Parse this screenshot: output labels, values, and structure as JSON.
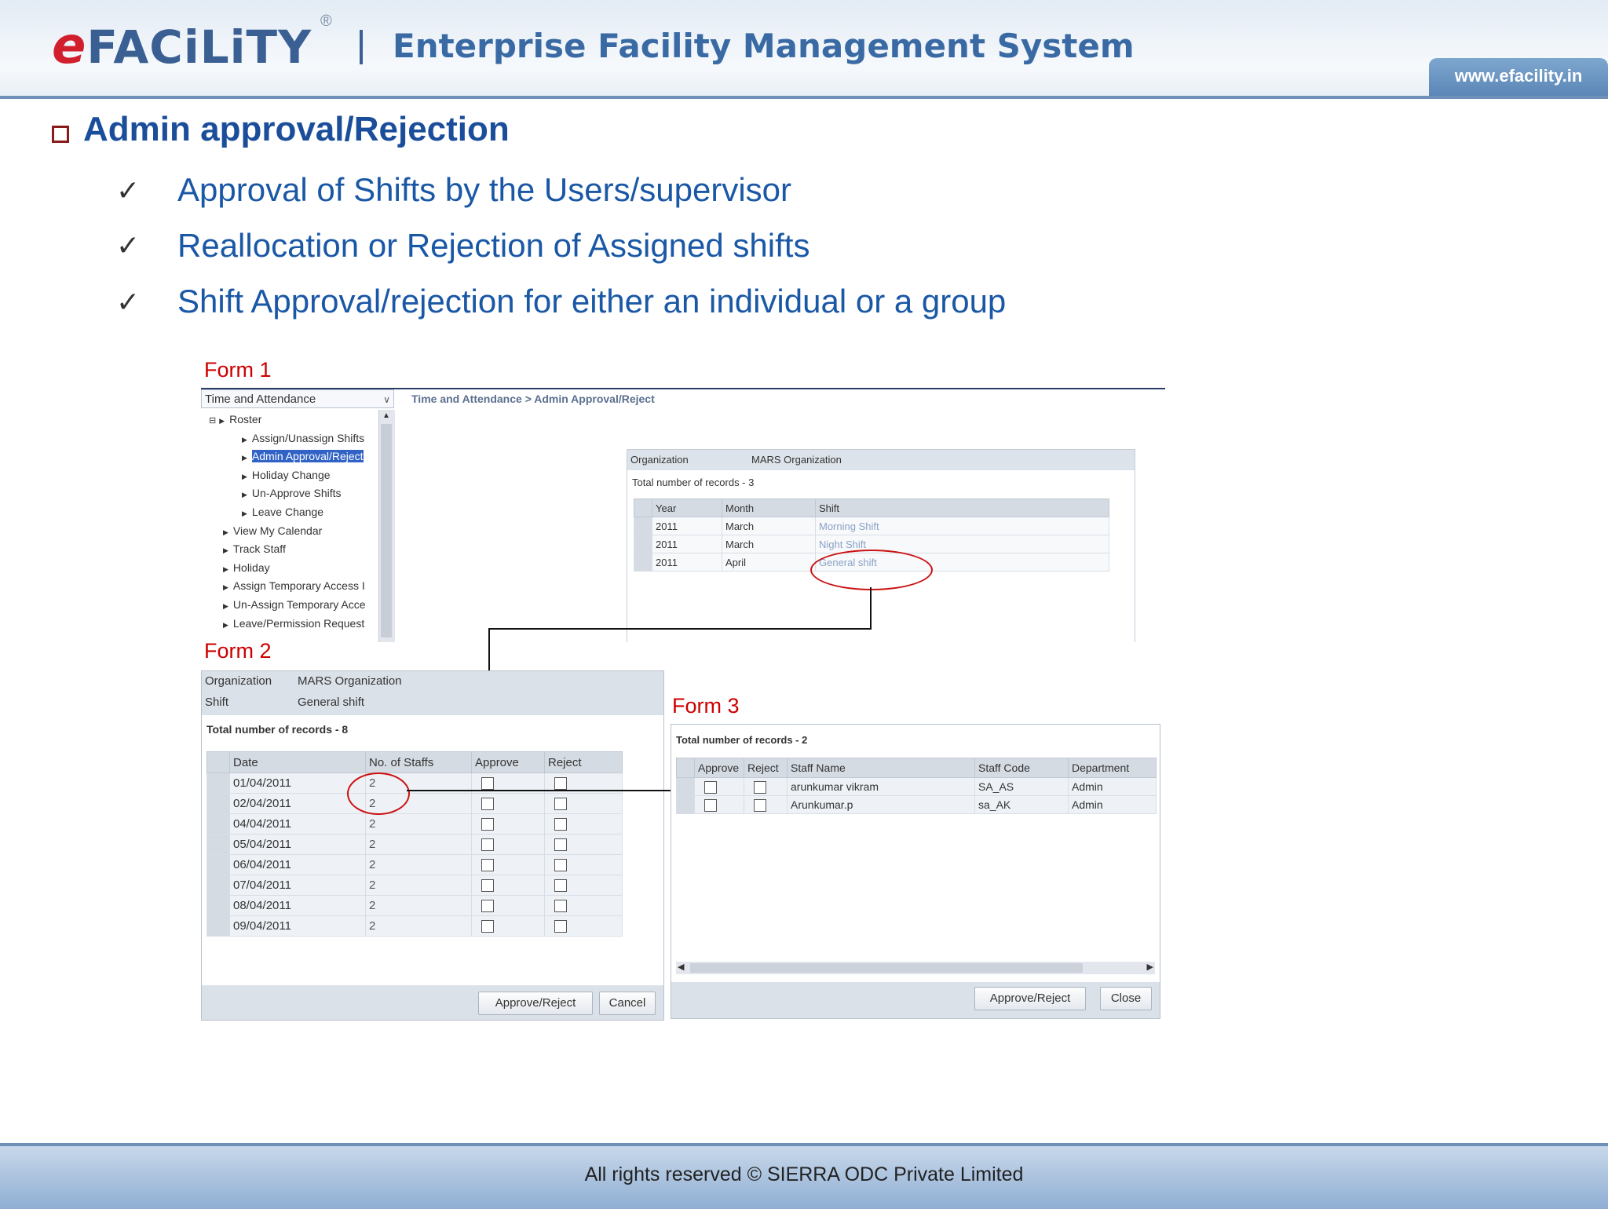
{
  "header": {
    "logo_text": "FACiLiTY",
    "logo_e": "e",
    "registered_mark": "®",
    "app_title": "Enterprise Facility Management System",
    "url": "www.efacility.in"
  },
  "section_title": "Admin approval/Rejection",
  "bullets": [
    "Approval of Shifts by the Users/supervisor",
    "Reallocation or Rejection of Assigned shifts",
    "Shift Approval/rejection for either an individual or a group"
  ],
  "check_glyph": "✓",
  "form_labels": [
    "Form 1",
    "Form 2",
    "Form 3"
  ],
  "form1": {
    "module_select": "Time and Attendance",
    "breadcrumb": "Time and Attendance > Admin Approval/Reject",
    "tree": [
      "Roster",
      "Assign/Unassign Shifts",
      "Admin Approval/Reject",
      "Holiday Change",
      "Un-Approve Shifts",
      "Leave Change",
      "View My Calendar",
      "Track Staff",
      "Holiday",
      "Assign Temporary Access I",
      "Un-Assign Temporary Acce",
      "Leave/Permission Request"
    ],
    "org_label": "Organization",
    "org_value": "MARS Organization",
    "total_records": "Total number of records - 3",
    "columns": [
      "Year",
      "Month",
      "Shift"
    ],
    "rows": [
      [
        "2011",
        "March",
        "Morning Shift"
      ],
      [
        "2011",
        "March",
        "Night Shift"
      ],
      [
        "2011",
        "April",
        "General shift"
      ]
    ]
  },
  "form2": {
    "org_label": "Organization",
    "org_value": "MARS Organization",
    "shift_label": "Shift",
    "shift_value": "General shift",
    "total_records": "Total number of records - 8",
    "columns": [
      "Date",
      "No. of Staffs",
      "Approve",
      "Reject"
    ],
    "rows": [
      [
        "01/04/2011",
        "2"
      ],
      [
        "02/04/2011",
        "2"
      ],
      [
        "04/04/2011",
        "2"
      ],
      [
        "05/04/2011",
        "2"
      ],
      [
        "06/04/2011",
        "2"
      ],
      [
        "07/04/2011",
        "2"
      ],
      [
        "08/04/2011",
        "2"
      ],
      [
        "09/04/2011",
        "2"
      ]
    ],
    "approve_reject_button": "Approve/Reject",
    "cancel_button": "Cancel"
  },
  "form3": {
    "total_records": "Total number of records - 2",
    "columns": [
      "Approve",
      "Reject",
      "Staff Name",
      "Staff Code",
      "Department"
    ],
    "rows": [
      [
        "arunkumar vikram",
        "SA_AS",
        "Admin"
      ],
      [
        "Arunkumar.p",
        "sa_AK",
        "Admin"
      ]
    ],
    "approve_reject_button": "Approve/Reject",
    "close_button": "Close"
  },
  "footer": {
    "copyright": "All rights reserved © SIERRA ODC Private Limited"
  },
  "colors": {
    "title_blue": "#1b4e9a",
    "bullet_blue": "#1a58a6",
    "form_label_red": "#cc0000",
    "annotation_red": "#cc1111",
    "selection_blue": "#3163c6"
  }
}
